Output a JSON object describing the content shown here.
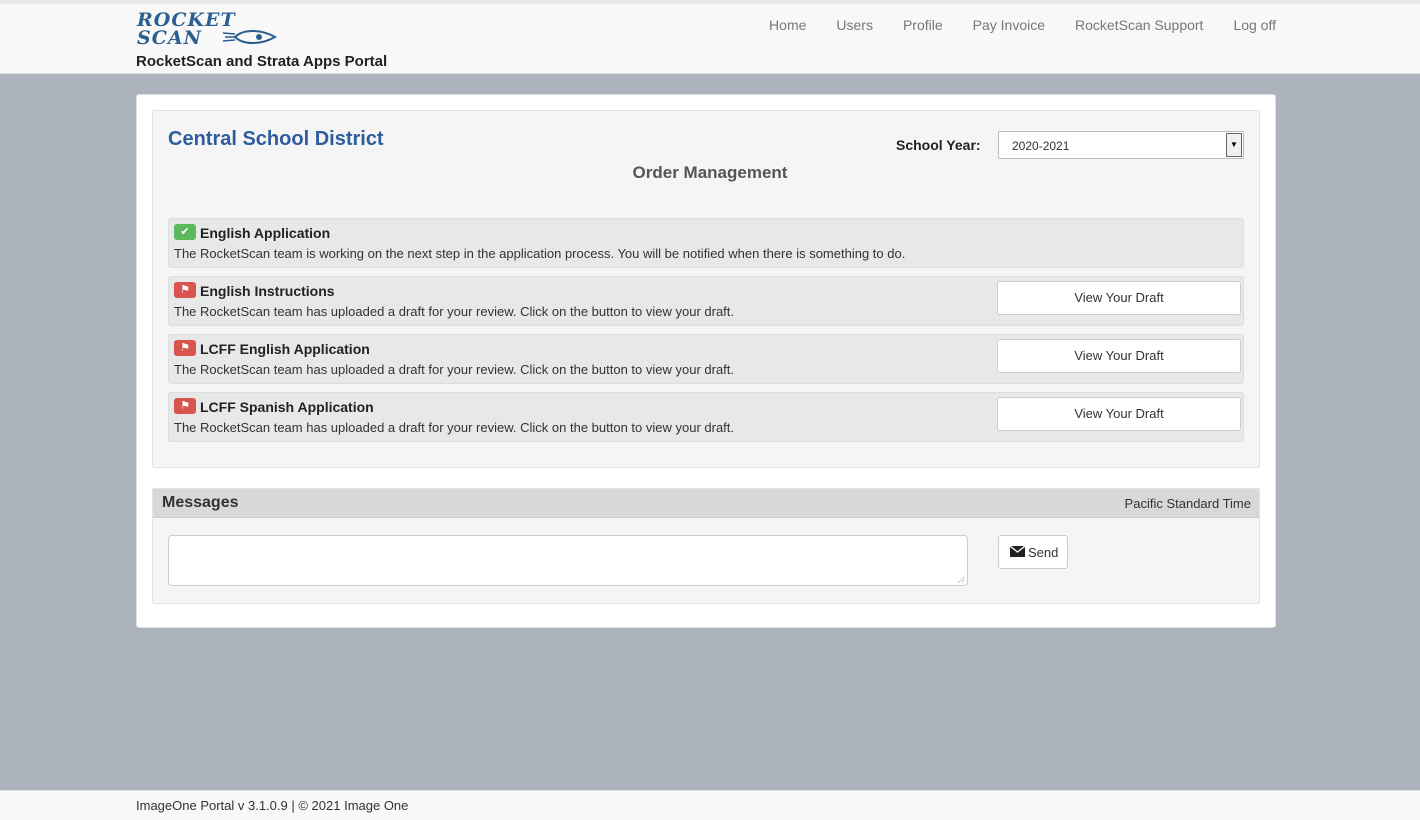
{
  "header": {
    "logo_line1": "ROCKET",
    "logo_line2": "SCAN",
    "portal_title": "RocketScan and Strata Apps Portal",
    "nav": [
      "Home",
      "Users",
      "Profile",
      "Pay Invoice",
      "RocketScan Support",
      "Log off"
    ]
  },
  "main": {
    "district": "Central School District",
    "school_year_label": "School Year:",
    "school_year_value": "2020-2021",
    "section_title": "Order Management",
    "items": [
      {
        "status": "complete",
        "icon": "check-icon",
        "title": "English Application",
        "description": "The RocketScan team is working on the next step in the application process. You will be notified when there is something to do."
      },
      {
        "status": "action",
        "icon": "flag-icon",
        "title": "English Instructions",
        "description": "The RocketScan team has uploaded a draft for your review. Click on the button to view your draft.",
        "button": "View Your Draft"
      },
      {
        "status": "action",
        "icon": "flag-icon",
        "title": "LCFF English Application",
        "description": "The RocketScan team has uploaded a draft for your review. Click on the button to view your draft.",
        "button": "View Your Draft"
      },
      {
        "status": "action",
        "icon": "flag-icon",
        "title": "LCFF Spanish Application",
        "description": "The RocketScan team has uploaded a draft for your review. Click on the button to view your draft.",
        "button": "View Your Draft"
      }
    ]
  },
  "messages": {
    "title": "Messages",
    "timezone": "Pacific Standard Time",
    "input_value": "",
    "send_label": "Send"
  },
  "footer": {
    "text": "ImageOne Portal v 3.1.0.9 | © 2021 Image One"
  },
  "colors": {
    "brand_blue": "#2e5d9e",
    "ok_green": "#5cb85c",
    "flag_red": "#d9534f",
    "page_bg": "#adb3bd"
  }
}
